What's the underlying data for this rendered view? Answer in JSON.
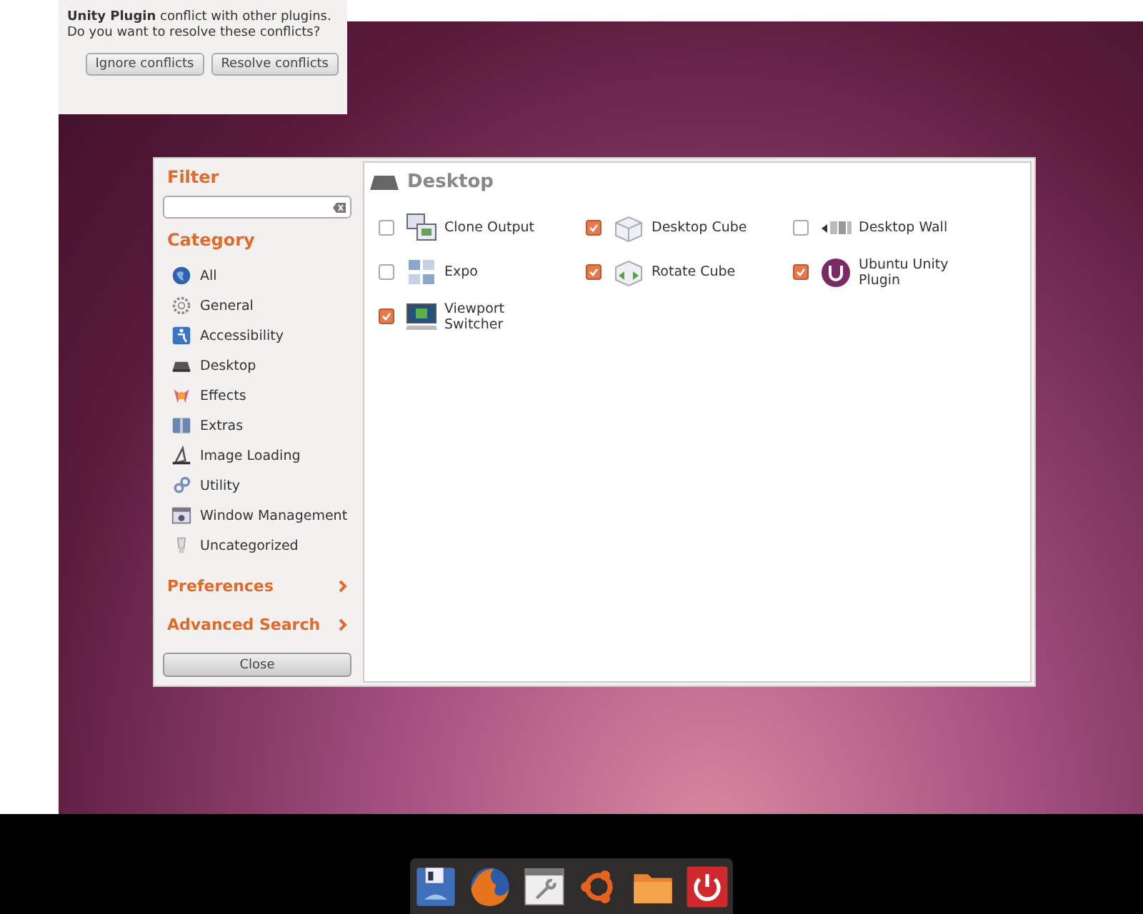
{
  "dialog": {
    "message": "**Unity Plugin** conflict with other plugins. Do you want to resolve these conflicts?",
    "buttons": [
      "Ignore conflicts",
      "Resolve conflicts"
    ]
  },
  "sidebar": {
    "filter_heading": "Filter",
    "category_heading": "Category",
    "categories": [
      {
        "label": "All"
      },
      {
        "label": "General"
      },
      {
        "label": "Accessibility"
      },
      {
        "label": "Desktop"
      },
      {
        "label": "Effects"
      },
      {
        "label": "Extras"
      },
      {
        "label": "Image Loading"
      },
      {
        "label": "Utility"
      },
      {
        "label": "Window Management"
      },
      {
        "label": "Uncategorized"
      }
    ],
    "expanders": [
      {
        "label": "Preferences"
      },
      {
        "label": "Advanced Search"
      }
    ],
    "close_button": "Close"
  },
  "content": {
    "title": "Desktop",
    "plugins": [
      {
        "label": "Clone Output",
        "checked": false
      },
      {
        "label": "Desktop Cube",
        "checked": true
      },
      {
        "label": "Desktop Wall",
        "checked": false
      },
      {
        "label": "Expo",
        "checked": false
      },
      {
        "label": "Rotate Cube",
        "checked": true
      },
      {
        "label": "Ubuntu Unity Plugin",
        "checked": true
      },
      {
        "label": "Viewport Switcher",
        "checked": true
      }
    ]
  }
}
